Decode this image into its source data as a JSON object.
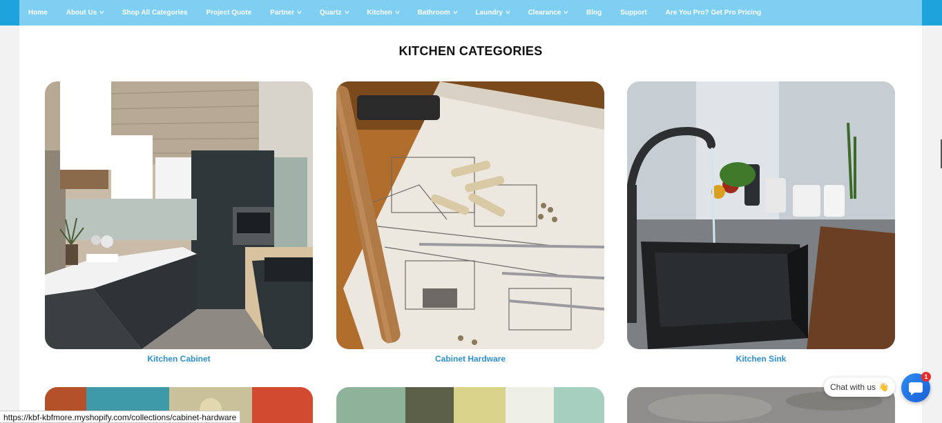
{
  "nav": {
    "items": [
      {
        "label": "Home"
      },
      {
        "label": "About Us",
        "dropdown": true
      },
      {
        "label": "Shop All Categories"
      },
      {
        "label": "Project Quote"
      },
      {
        "label": "Partner",
        "dropdown": true
      },
      {
        "label": "Quartz",
        "dropdown": true
      },
      {
        "label": "Kitchen",
        "dropdown": true
      },
      {
        "label": "Bathroom",
        "dropdown": true
      },
      {
        "label": "Laundry",
        "dropdown": true
      },
      {
        "label": "Clearance",
        "dropdown": true
      },
      {
        "label": "Blog"
      },
      {
        "label": "Support"
      },
      {
        "label": "Are You Pro? Get Pro Pricing"
      }
    ]
  },
  "page": {
    "title": "KITCHEN CATEGORIES"
  },
  "categories": [
    {
      "label": "Kitchen Cabinet"
    },
    {
      "label": "Cabinet Hardware"
    },
    {
      "label": "Kitchen Sink"
    }
  ],
  "status_bar": {
    "url": "https://kbf-kbfmore.myshopify.com/collections/cabinet-hardware"
  },
  "chat": {
    "label": "Chat with us",
    "emoji": "👋",
    "badge": "1"
  },
  "colors": {
    "nav_bg": "#7fcff2",
    "nav_edge": "#1ea3dc",
    "label_blue": "#2b8fd1"
  }
}
